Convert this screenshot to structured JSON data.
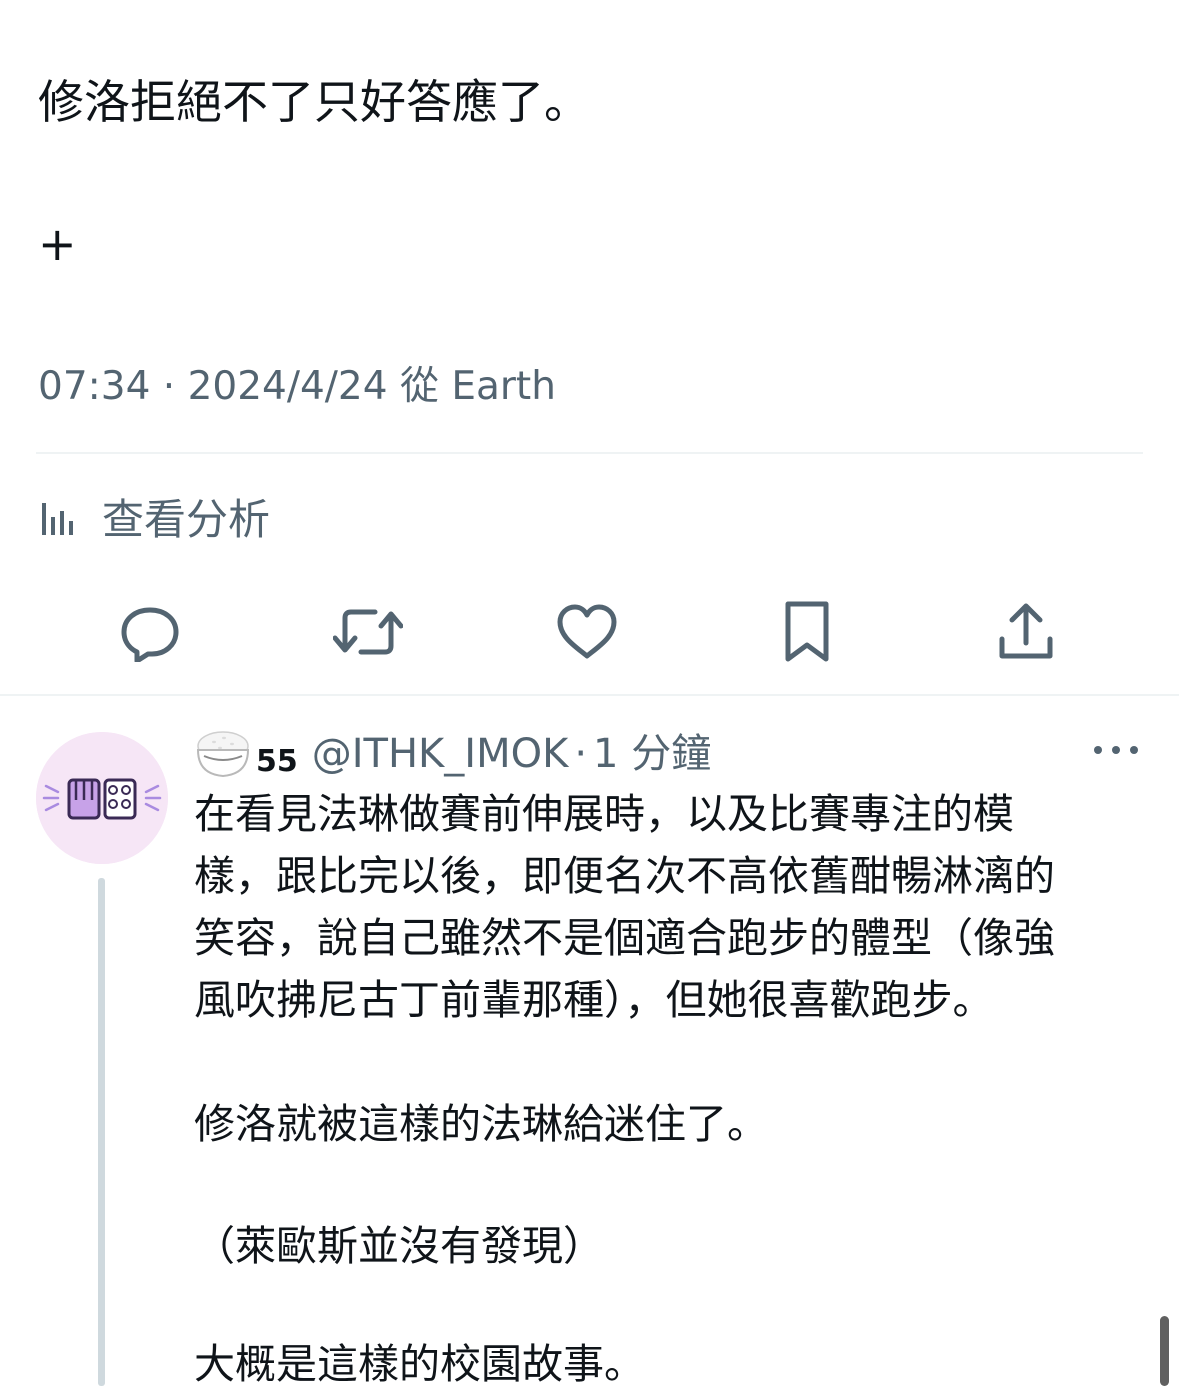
{
  "main_tweet": {
    "text_line_1": "修洛拒絕不了只好答應了。",
    "text_line_2": "+",
    "meta": "07:34 · 2024/4/24 從 Earth",
    "analytics_label": "查看分析"
  },
  "actions": [
    {
      "icon": "reply-icon"
    },
    {
      "icon": "retweet-icon"
    },
    {
      "icon": "like-icon"
    },
    {
      "icon": "bookmark-icon"
    },
    {
      "icon": "share-icon"
    }
  ],
  "reply": {
    "display_name_emoji": "rice-bowl-emoji",
    "display_name_number": "55",
    "handle": "@ITHK_IMOK",
    "separator": "·",
    "relative_time": "1 分鐘",
    "more_icon": "more-icon",
    "text_lines": [
      "在看見法琳做賽前伸展時，以及比賽專注的模",
      "樣，跟比完以後，即便名次不高依舊酣暢淋漓的",
      "笑容，說自己雖然不是個適合跑步的體型（像強",
      "風吹拂尼古丁前輩那種），但她很喜歡跑步。",
      "修洛就被這樣的法琳給迷住了。",
      "（萊歐斯並沒有發現）",
      "大概是這樣的校園故事。"
    ]
  },
  "colors": {
    "text_primary": "#0f1419",
    "text_secondary": "#536471",
    "divider": "#eff3f4",
    "thread_line": "#cfd9de",
    "avatar_bg": "#f6e6f6"
  }
}
